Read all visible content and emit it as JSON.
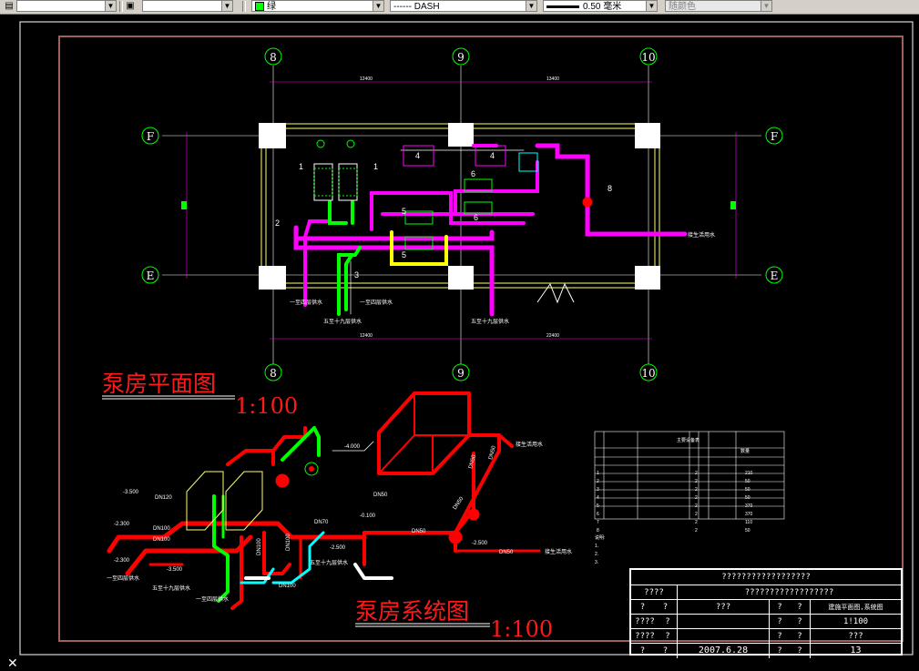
{
  "toolbar": {
    "layer_combo": "",
    "style_combo": "",
    "color_combo": "绿",
    "linetype_combo": "------ DASH",
    "lineweight_combo": "0.50 毫米",
    "plotstyle_combo": "随颜色"
  },
  "grid_bubbles": {
    "top": [
      "8",
      "9",
      "10"
    ],
    "bottom": [
      "8",
      "9",
      "10"
    ],
    "left": [
      "F",
      "E"
    ],
    "right": [
      "F",
      "E"
    ]
  },
  "dimensions": {
    "top_left": "12400",
    "top_right": "13400",
    "bottom_left": "12400",
    "bottom_right": "22400"
  },
  "plan_labels": {
    "equip_1a": "1",
    "equip_1b": "1",
    "equip_2": "2",
    "equip_3": "3",
    "equip_4a": "4",
    "equip_4b": "4",
    "equip_5a": "5",
    "equip_5b": "5",
    "equip_6a": "6",
    "equip_6b": "6",
    "equip_8": "8",
    "out_right": "接生活用水",
    "out_a": "一至四层供水",
    "out_b": "五至十九层供水",
    "out_c": "一至四层供水",
    "out_d": "五至十九层供水"
  },
  "titles": {
    "plan_title": "泵房平面图",
    "plan_scale": "1:100",
    "system_title": "泵房系统图",
    "system_scale": "1:100"
  },
  "system_labels": {
    "el_1": "-3.500",
    "el_2": "-2.300",
    "el_3": "-2.300",
    "el_4": "-3.500",
    "el_5": "-4.000",
    "el_6": "-0.100",
    "el_7": "-2.500",
    "el_8": "-2.500",
    "dn120": "DN120",
    "dn100a": "DN100",
    "dn100b": "DN100",
    "dn100c": "DN100",
    "dn100d": "DN100",
    "dn70": "DN70",
    "dn50a": "DN50",
    "dn50b": "DN50",
    "dn50c": "DN50",
    "dn50d": "DN50",
    "dn50e": "DN50",
    "dn50f": "DN50",
    "dn100e": "DN100",
    "sys_out_1": "一至四层供水",
    "sys_out_2": "五至十九层供水",
    "sys_out_3": "一至四层供水",
    "sys_out_4": "五至十九层供水",
    "sys_out_5": "接生活用水",
    "sys_out_6": "接生活用水"
  },
  "equipment_table": {
    "title": "主要设备表",
    "headers": [
      "",
      "",
      "",
      "",
      "",
      "",
      "数量"
    ],
    "rows": [
      [
        "1",
        "",
        "",
        "",
        "2",
        "",
        "210"
      ],
      [
        "2",
        "",
        "",
        "",
        "2",
        "",
        "50"
      ],
      [
        "3",
        "",
        "",
        "",
        "2",
        "",
        "50"
      ],
      [
        "4",
        "",
        "",
        "",
        "2",
        "",
        "50"
      ],
      [
        "5",
        "",
        "",
        "",
        "2",
        "",
        "370"
      ],
      [
        "6",
        "",
        "",
        "",
        "2",
        "",
        "370"
      ],
      [
        "7",
        "",
        "",
        "",
        "2",
        "",
        "110"
      ],
      [
        "8",
        "",
        "",
        "",
        "2",
        "",
        "50"
      ]
    ]
  },
  "notes": {
    "n0": "说明:",
    "n1": "1. ",
    "n2": "2. ",
    "n3": "3. "
  },
  "title_block": {
    "r1c1": "??????????????????",
    "r2c1": "????",
    "r2c2": "??????????????????",
    "r3c1": "?",
    "r3c2": "?",
    "r3c3": "???",
    "r3c4": "?",
    "r3c5": "?",
    "r3c6": "建施平面图,系统图",
    "r4c1": "????",
    "r4c2": "?",
    "r4c3": "?",
    "r4c4": "?",
    "r4c5": "1!100",
    "r5c1": "????",
    "r5c2": "?",
    "r5c3": "?",
    "r5c4": "?",
    "r5c5": "???",
    "r6c1": "?",
    "r6c2": "?",
    "r6c3": "2007.6.28",
    "r6c4": "?",
    "r6c5": "?",
    "r6c6": "13"
  },
  "colors": {
    "background": "#000000",
    "magenta": "#ff00ff",
    "red": "#ff0000",
    "green": "#00ff00",
    "yellow": "#ffff00",
    "cyan": "#00ffff",
    "white": "#ffffff",
    "frame": "#a06060"
  }
}
